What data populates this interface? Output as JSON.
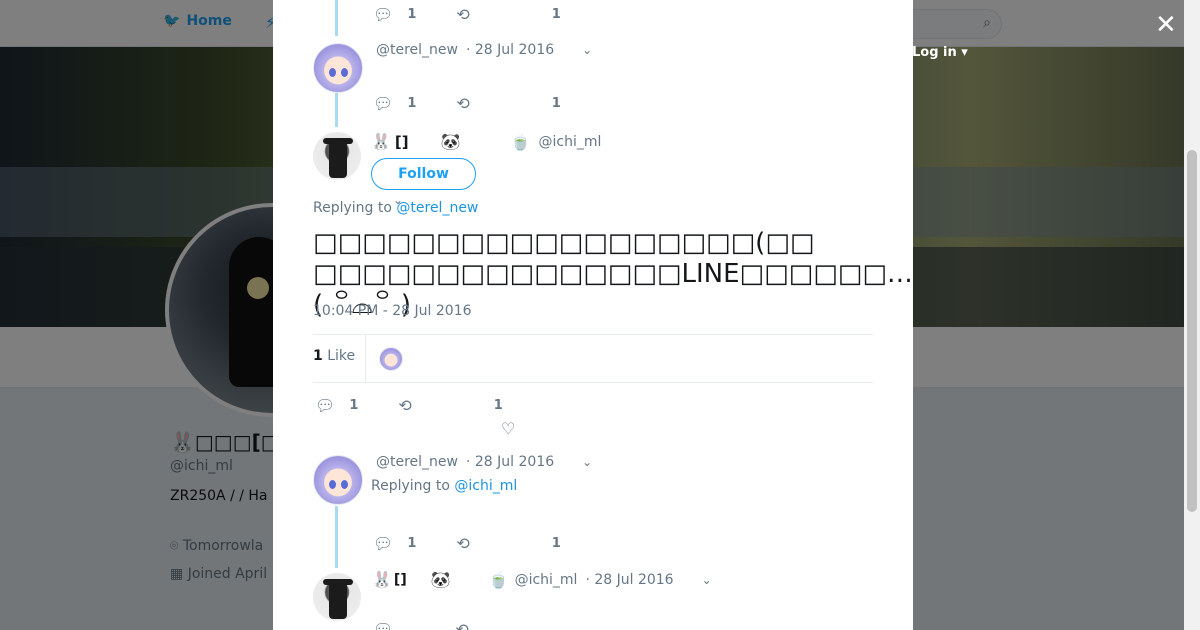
{
  "topbar": {
    "home_label": "Home",
    "login_label": "Log in"
  },
  "profile": {
    "name": "🐰□□□[□]",
    "handle": "@ichi_ml",
    "bio": "ZR250A /  / Ha",
    "location": "Tomorrowla",
    "joined": "Joined April"
  },
  "modal": {
    "tweet0_actions": {
      "replies": "1",
      "likes": "1"
    },
    "tweet1": {
      "handle": "@terel_new",
      "date": "· 28 Jul 2016",
      "replies": "1",
      "likes": "1"
    },
    "focus": {
      "name_prefix": "🐰",
      "name_bracket": "[]",
      "panda": "🐼",
      "matcha": "🍵",
      "handle": "@ichi_ml",
      "follow_label": "Follow",
      "replying_prefix": "Replying to",
      "replying_handle": "@terel_new",
      "text_line1": "□□□□□□□□□□□□□□□□□□(□□",
      "text_line2": "□□□□□□□□□□□□□□□LINE□□□□□□…( ꒪⌓꒪ )",
      "timestamp": "10:04 PM - 28 Jul 2016",
      "likes_count": "1",
      "likes_label": "Like",
      "replies": "1",
      "like_count": "1"
    },
    "tweet2": {
      "handle": "@terel_new",
      "date": "· 28 Jul 2016",
      "replying_prefix": "Replying to",
      "replying_handle": "@ichi_ml",
      "replies": "1",
      "likes": "1"
    },
    "tweet3": {
      "name_prefix": "🐰",
      "name_bracket": "[]",
      "panda": "🐼",
      "matcha": "🍵",
      "handle": "@ichi_ml",
      "date": "· 28 Jul 2016"
    }
  },
  "colors": {
    "accent": "#1da1f2",
    "thread": "#a8daf2",
    "muted": "#657786"
  },
  "icons": {
    "close": "close-icon",
    "reply": "reply-icon",
    "retweet": "retweet-icon",
    "like": "heart-icon",
    "chevron": "chevron-down-icon"
  }
}
